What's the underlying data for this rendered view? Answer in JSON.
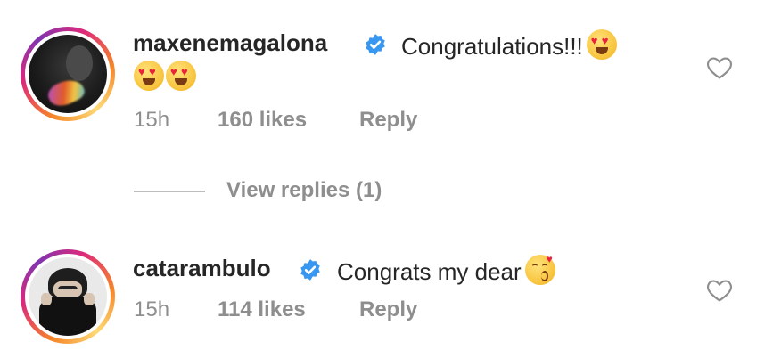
{
  "comments": [
    {
      "username": "maxenemagalona",
      "verified": true,
      "text_line1": "Congratulations!!!",
      "time": "15h",
      "likes": "160 likes",
      "reply": "Reply",
      "emoji_line1": [
        "heart-eyes-emoji"
      ],
      "emoji_line2": [
        "heart-eyes-emoji",
        "heart-eyes-emoji"
      ]
    },
    {
      "username": "catarambulo",
      "verified": true,
      "text_line1": "Congrats my dear",
      "time": "15h",
      "likes": "114 likes",
      "reply": "Reply",
      "emoji_line1": [
        "kissing-face-emoji"
      ]
    }
  ],
  "view_replies": "View replies (1)",
  "colors": {
    "text": "#262626",
    "meta": "#8e8e8e",
    "verified": "#3897f0",
    "avatar_ring_start": "#f58529",
    "avatar_ring_end": "#dd2a7b"
  },
  "icons": {
    "like": "heart-outline-icon",
    "verified": "verified-badge-icon"
  }
}
